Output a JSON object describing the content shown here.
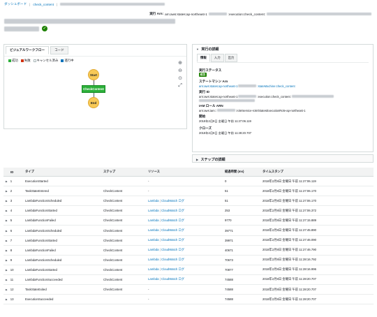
{
  "breadcrumb": {
    "items": [
      "ダッシュボード",
      "check_content"
    ]
  },
  "header": {
    "arn_label": "実行 Arn:",
    "arn_prefix": "arn:aws:states:ap-northeast-1",
    "arn_mid": ":execution:check_content:"
  },
  "graph": {
    "tabs": [
      "ビジュアルワークフロー",
      "コード"
    ],
    "legend": [
      {
        "label": "成功",
        "color": "#2cb03a"
      },
      {
        "label": "失敗",
        "color": "#d13212"
      },
      {
        "label": "キャンセル済み",
        "color": "#d5dbdb"
      },
      {
        "label": "進行中",
        "color": "#0073bb"
      }
    ],
    "nodes": {
      "start": "Start",
      "task": "CheckContent",
      "end": "End"
    },
    "zoom_in_icon": "⊕",
    "zoom_out_icon": "⊖",
    "center_icon": "⊙",
    "expand_icon": "⤢"
  },
  "details": {
    "header": "実行の詳細",
    "tabs": [
      "情報",
      "入力",
      "出力"
    ],
    "status_label": "実行ステータス",
    "status_value": "成功",
    "sm_arn_label": "ステートマシン Arn",
    "sm_arn_prefix": "arn:aws:states:ap-northeast-1",
    "sm_arn_suffix": ":stateMachine:check_content",
    "exec_id_label": "実行 ID",
    "exec_id_prefix": "arn:aws:states:ap-northeast-1",
    "exec_id_mid": ":execution:check_content:",
    "iam_label": "IAM ロール ARN",
    "iam_prefix": "arn:aws:iam::",
    "iam_suffix": ":role/service-role/StatesExecutionRole-ap-northeast-1",
    "start_label": "開始",
    "start_value": "2018年2月9日 金曜日 午前 11:27:06.119",
    "close_label": "クローズ",
    "close_value": "2018年2月9日 金曜日 午前 11:28:20.707"
  },
  "step_details": {
    "header": "ステップの詳細"
  },
  "events": {
    "columns": [
      "ID",
      "タイプ",
      "ステップ",
      "リソース",
      "経過時間 (ms)",
      "タイムスタンプ"
    ],
    "lambda_link": "Lambda",
    "cw_link": "CloudWatch ログ",
    "rows": [
      {
        "id": "1",
        "type": "ExecutionStarted",
        "step": "",
        "resource": "-",
        "elapsed": "0",
        "ts": "2018年2月9日 金曜日 午前 11:27:06.119"
      },
      {
        "id": "2",
        "type": "TaskStateEntered",
        "step": "CheckContent",
        "resource": "-",
        "elapsed": "51",
        "ts": "2018年2月9日 金曜日 午前 11:27:06.170"
      },
      {
        "id": "3",
        "type": "LambdaFunctionScheduled",
        "step": "CheckContent",
        "resource": "link",
        "elapsed": "51",
        "ts": "2018年2月9日 金曜日 午前 11:27:06.170"
      },
      {
        "id": "4",
        "type": "LambdaFunctionStarted",
        "step": "CheckContent",
        "resource": "link",
        "elapsed": "253",
        "ts": "2018年2月9日 金曜日 午前 11:27:06.372"
      },
      {
        "id": "5",
        "type": "LambdaFunctionFailed",
        "step": "CheckContent",
        "resource": "link",
        "elapsed": "9770",
        "ts": "2018年2月9日 金曜日 午前 11:27:15.889"
      },
      {
        "id": "6",
        "type": "LambdaFunctionScheduled",
        "step": "CheckContent",
        "resource": "link",
        "elapsed": "39771",
        "ts": "2018年2月9日 金曜日 午前 11:27:45.890"
      },
      {
        "id": "7",
        "type": "LambdaFunctionStarted",
        "step": "CheckContent",
        "resource": "link",
        "elapsed": "39971",
        "ts": "2018年2月9日 金曜日 午前 11:27:46.090"
      },
      {
        "id": "8",
        "type": "LambdaFunctionFailed",
        "step": "CheckContent",
        "resource": "link",
        "elapsed": "40671",
        "ts": "2018年2月9日 金曜日 午前 11:27:46.790"
      },
      {
        "id": "9",
        "type": "LambdaFunctionScheduled",
        "step": "CheckContent",
        "resource": "link",
        "elapsed": "70673",
        "ts": "2018年2月9日 金曜日 午前 11:28:16.792"
      },
      {
        "id": "10",
        "type": "LambdaFunctionStarted",
        "step": "CheckContent",
        "resource": "link",
        "elapsed": "70877",
        "ts": "2018年2月9日 金曜日 午前 11:28:16.996"
      },
      {
        "id": "11",
        "type": "LambdaFunctionSucceeded",
        "step": "CheckContent",
        "resource": "link",
        "elapsed": "74588",
        "ts": "2018年2月9日 金曜日 午前 11:28:20.707"
      },
      {
        "id": "12",
        "type": "TaskStateExited",
        "step": "CheckContent",
        "resource": "-",
        "elapsed": "74588",
        "ts": "2018年2月9日 金曜日 午前 11:28:20.707"
      },
      {
        "id": "13",
        "type": "ExecutionSucceeded",
        "step": "",
        "resource": "-",
        "elapsed": "74588",
        "ts": "2018年2月9日 金曜日 午前 11:28:20.707"
      }
    ]
  }
}
